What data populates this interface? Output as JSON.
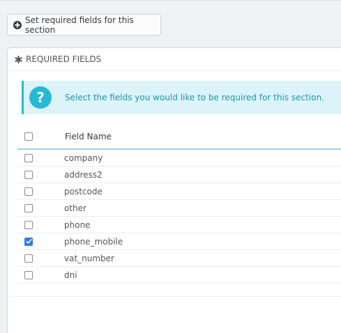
{
  "toolbar": {
    "set_required_label": "Set required fields for this section",
    "set_required_icon": "plus-circle-icon"
  },
  "panel": {
    "heading": "REQUIRED FIELDS",
    "heading_icon": "asterisk-icon",
    "alert": {
      "icon": "question-icon",
      "icon_glyph": "?",
      "text": "Select the fields you would like to be required for this section."
    },
    "table": {
      "header": "Field Name",
      "rows": [
        {
          "label": "company",
          "checked": false
        },
        {
          "label": "address2",
          "checked": false
        },
        {
          "label": "postcode",
          "checked": false
        },
        {
          "label": "other",
          "checked": false
        },
        {
          "label": "phone",
          "checked": false
        },
        {
          "label": "phone_mobile",
          "checked": true
        },
        {
          "label": "vat_number",
          "checked": false
        },
        {
          "label": "dni",
          "checked": false
        }
      ]
    }
  },
  "colors": {
    "accent": "#25b9d7",
    "checkbox_checked": "#2f7ae5",
    "header_border": "#a0d0eb"
  }
}
